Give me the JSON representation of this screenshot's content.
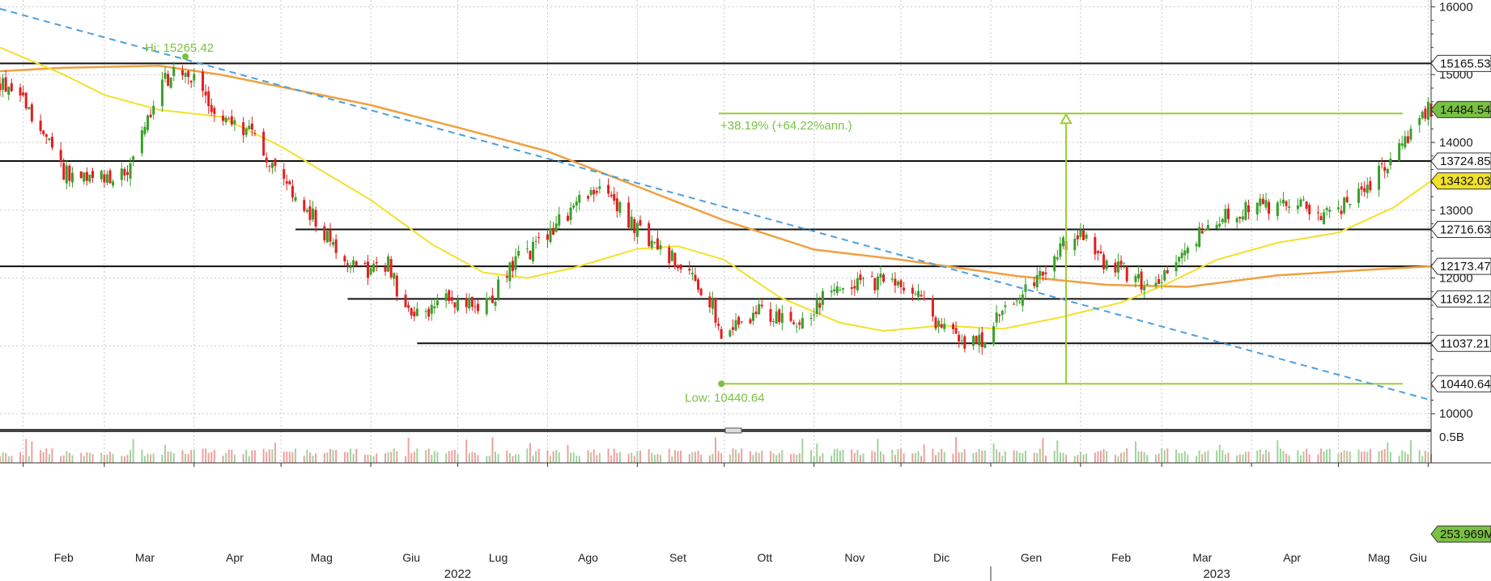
{
  "chart_data": {
    "type": "candlestick",
    "title": "",
    "y_axis": {
      "ticks": [
        10000,
        11000,
        12000,
        13000,
        14000,
        15000,
        16000
      ],
      "range": [
        9800,
        16100
      ],
      "position": "right"
    },
    "x_axis": {
      "months": [
        "Feb",
        "Mar",
        "Apr",
        "Mag",
        "Giu",
        "Lug",
        "Ago",
        "Set",
        "Ott",
        "Nov",
        "Dic",
        "Gen",
        "Feb",
        "Mar",
        "Apr",
        "Mag",
        "Giu"
      ],
      "years": [
        "2022",
        "2023"
      ],
      "range": [
        "2022-01-24",
        "2023-06-02"
      ]
    },
    "horizontal_levels": [
      15165.53,
      13724.85,
      12716.63,
      12173.47,
      11692.12,
      11037.21
    ],
    "level_labels": [
      "15165.53",
      "13724.85",
      "12716.63",
      "12173.47",
      "11692.12",
      "11037.21"
    ],
    "low_level": {
      "value": 10440.64,
      "label": "10440.64",
      "from": "2022-09-30"
    },
    "high_marker": {
      "label": "Hi: 15265.42",
      "value": 15265.42,
      "date": "2022-03-29"
    },
    "low_marker": {
      "label": "Low: 10440.64",
      "value": 10440.64,
      "date": "2022-09-30"
    },
    "measurement": {
      "label": "+38.19% (+64.22%ann.)",
      "from": 10440.64,
      "to": 14427,
      "date": "2023-01-27"
    },
    "last_price": {
      "value": 14484.54,
      "label": "14484.54",
      "color": "#7ac143"
    },
    "ma_fast": {
      "name": "",
      "last_value": 13432.03,
      "label": "13432.03",
      "color": "#f2e12a",
      "points": [
        [
          "2022-01-24",
          15400
        ],
        [
          "2022-02-15",
          15000
        ],
        [
          "2022-03-01",
          14700
        ],
        [
          "2022-03-20",
          14480
        ],
        [
          "2022-04-10",
          14380
        ],
        [
          "2022-05-01",
          13940
        ],
        [
          "2022-06-01",
          13150
        ],
        [
          "2022-06-22",
          12500
        ],
        [
          "2022-07-10",
          12080
        ],
        [
          "2022-07-25",
          12000
        ],
        [
          "2022-08-10",
          12150
        ],
        [
          "2022-09-01",
          12430
        ],
        [
          "2022-09-15",
          12470
        ],
        [
          "2022-10-01",
          12270
        ],
        [
          "2022-10-20",
          11720
        ],
        [
          "2022-11-10",
          11340
        ],
        [
          "2022-11-25",
          11220
        ],
        [
          "2022-12-15",
          11300
        ],
        [
          "2023-01-05",
          11250
        ],
        [
          "2023-01-25",
          11420
        ],
        [
          "2023-02-15",
          11640
        ],
        [
          "2023-03-01",
          11880
        ],
        [
          "2023-03-20",
          12270
        ],
        [
          "2023-04-10",
          12520
        ],
        [
          "2023-05-01",
          12670
        ],
        [
          "2023-05-20",
          13040
        ],
        [
          "2023-06-02",
          13432
        ]
      ]
    },
    "ma_slow": {
      "name": "",
      "last_value": 12173.47,
      "label": "12173.47",
      "color": "#f0a040",
      "points": [
        [
          "2022-01-24",
          15050
        ],
        [
          "2022-02-15",
          15100
        ],
        [
          "2022-03-20",
          15130
        ],
        [
          "2022-04-10",
          15000
        ],
        [
          "2022-05-01",
          14820
        ],
        [
          "2022-06-01",
          14550
        ],
        [
          "2022-07-01",
          14220
        ],
        [
          "2022-08-01",
          13870
        ],
        [
          "2022-09-01",
          13350
        ],
        [
          "2022-10-01",
          12850
        ],
        [
          "2022-11-01",
          12420
        ],
        [
          "2022-12-01",
          12270
        ],
        [
          "2023-01-10",
          12030
        ],
        [
          "2023-02-10",
          11900
        ],
        [
          "2023-03-10",
          11870
        ],
        [
          "2023-04-10",
          12040
        ],
        [
          "2023-05-10",
          12120
        ],
        [
          "2023-06-02",
          12173
        ]
      ]
    },
    "trendline": {
      "style": "dashed",
      "color": "#4aa0e0",
      "points": [
        [
          "2022-01-24",
          15970
        ],
        [
          "2023-06-02",
          10200
        ]
      ]
    },
    "volume": {
      "last_label": "253.969M",
      "axis_label": "0.5B",
      "color": "#f0a0a0"
    },
    "price_points": [
      [
        "2022-01-24",
        14900
      ],
      [
        "2022-01-31",
        14700
      ],
      [
        "2022-02-07",
        14200
      ],
      [
        "2022-02-14",
        13600
      ],
      [
        "2022-02-24",
        13400
      ],
      [
        "2022-03-01",
        13500
      ],
      [
        "2022-03-08",
        13500
      ],
      [
        "2022-03-15",
        14200
      ],
      [
        "2022-03-22",
        14900
      ],
      [
        "2022-03-29",
        15100
      ],
      [
        "2022-04-05",
        14600
      ],
      [
        "2022-04-12",
        14300
      ],
      [
        "2022-04-19",
        14200
      ],
      [
        "2022-04-26",
        13800
      ],
      [
        "2022-05-03",
        13300
      ],
      [
        "2022-05-12",
        12900
      ],
      [
        "2022-05-17",
        12600
      ],
      [
        "2022-05-24",
        12300
      ],
      [
        "2022-05-31",
        12100
      ],
      [
        "2022-06-07",
        12200
      ],
      [
        "2022-06-13",
        11500
      ],
      [
        "2022-06-20",
        11400
      ],
      [
        "2022-06-27",
        11700
      ],
      [
        "2022-07-05",
        11600
      ],
      [
        "2022-07-12",
        11600
      ],
      [
        "2022-07-19",
        12200
      ],
      [
        "2022-07-26",
        12400
      ],
      [
        "2022-08-02",
        12700
      ],
      [
        "2022-08-09",
        13000
      ],
      [
        "2022-08-16",
        13300
      ],
      [
        "2022-08-23",
        13200
      ],
      [
        "2022-08-30",
        12800
      ],
      [
        "2022-09-06",
        12500
      ],
      [
        "2022-09-13",
        12300
      ],
      [
        "2022-09-20",
        12000
      ],
      [
        "2022-09-27",
        11600
      ],
      [
        "2022-09-30",
        11200
      ],
      [
        "2022-10-05",
        11300
      ],
      [
        "2022-10-12",
        11500
      ],
      [
        "2022-10-19",
        11400
      ],
      [
        "2022-10-26",
        11300
      ],
      [
        "2022-11-02",
        11600
      ],
      [
        "2022-11-09",
        11900
      ],
      [
        "2022-11-16",
        11900
      ],
      [
        "2022-11-23",
        11950
      ],
      [
        "2022-11-30",
        11900
      ],
      [
        "2022-12-07",
        11700
      ],
      [
        "2022-12-14",
        11300
      ],
      [
        "2022-12-21",
        11100
      ],
      [
        "2022-12-28",
        11050
      ],
      [
        "2023-01-05",
        11500
      ],
      [
        "2023-01-12",
        11750
      ],
      [
        "2023-01-19",
        12050
      ],
      [
        "2023-01-26",
        12500
      ],
      [
        "2023-02-02",
        12600
      ],
      [
        "2023-02-09",
        12200
      ],
      [
        "2023-02-16",
        12100
      ],
      [
        "2023-02-23",
        11900
      ],
      [
        "2023-03-02",
        12000
      ],
      [
        "2023-03-09",
        12350
      ],
      [
        "2023-03-16",
        12750
      ],
      [
        "2023-03-23",
        12900
      ],
      [
        "2023-03-30",
        13050
      ],
      [
        "2023-04-06",
        13050
      ],
      [
        "2023-04-13",
        13100
      ],
      [
        "2023-04-20",
        13050
      ],
      [
        "2023-04-27",
        12950
      ],
      [
        "2023-05-04",
        13100
      ],
      [
        "2023-05-11",
        13300
      ],
      [
        "2023-05-18",
        13700
      ],
      [
        "2023-05-25",
        14100
      ],
      [
        "2023-06-01",
        14484.54
      ]
    ]
  }
}
